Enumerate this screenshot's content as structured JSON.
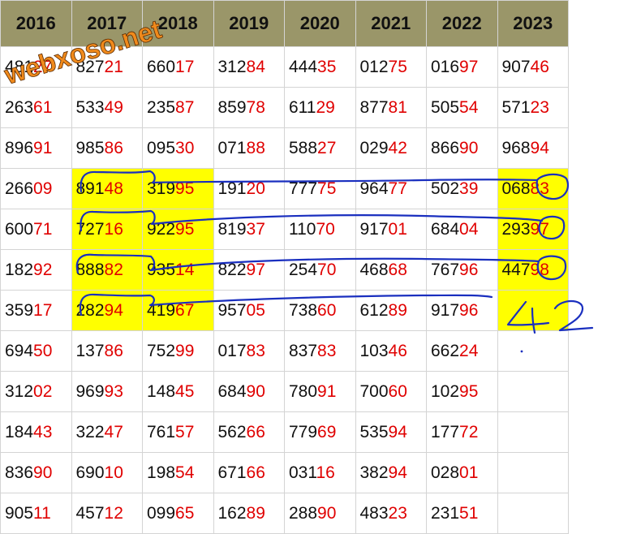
{
  "watermark": "webxoso.net",
  "headers": [
    "2016",
    "2017",
    "2018",
    "2019",
    "2020",
    "2021",
    "2022",
    "2023"
  ],
  "highlight_color": "#ffff00",
  "header_color": "#9a9669",
  "accent_red": "#e00000",
  "rows": [
    [
      {
        "h": "481",
        "l": "27"
      },
      {
        "h": "827",
        "l": "21"
      },
      {
        "h": "660",
        "l": "17"
      },
      {
        "h": "312",
        "l": "84"
      },
      {
        "h": "444",
        "l": "35"
      },
      {
        "h": "012",
        "l": "75"
      },
      {
        "h": "016",
        "l": "97"
      },
      {
        "h": "907",
        "l": "46"
      }
    ],
    [
      {
        "h": "263",
        "l": "61"
      },
      {
        "h": "533",
        "l": "49"
      },
      {
        "h": "235",
        "l": "87"
      },
      {
        "h": "859",
        "l": "78"
      },
      {
        "h": "611",
        "l": "29"
      },
      {
        "h": "877",
        "l": "81"
      },
      {
        "h": "505",
        "l": "54"
      },
      {
        "h": "571",
        "l": "23"
      }
    ],
    [
      {
        "h": "896",
        "l": "91"
      },
      {
        "h": "985",
        "l": "86"
      },
      {
        "h": "095",
        "l": "30"
      },
      {
        "h": "071",
        "l": "88"
      },
      {
        "h": "588",
        "l": "27"
      },
      {
        "h": "029",
        "l": "42"
      },
      {
        "h": "866",
        "l": "90"
      },
      {
        "h": "968",
        "l": "94"
      }
    ],
    [
      {
        "h": "266",
        "l": "09"
      },
      {
        "h": "891",
        "l": "48",
        "hl": true
      },
      {
        "h": "319",
        "l": "95",
        "hl": true
      },
      {
        "h": "191",
        "l": "20"
      },
      {
        "h": "777",
        "l": "75"
      },
      {
        "h": "964",
        "l": "77"
      },
      {
        "h": "502",
        "l": "39"
      },
      {
        "h": "068",
        "l": "83",
        "hl": true
      }
    ],
    [
      {
        "h": "600",
        "l": "71"
      },
      {
        "h": "727",
        "l": "16",
        "hl": true
      },
      {
        "h": "922",
        "l": "95",
        "hl": true
      },
      {
        "h": "819",
        "l": "37"
      },
      {
        "h": "110",
        "l": "70"
      },
      {
        "h": "917",
        "l": "01"
      },
      {
        "h": "684",
        "l": "04"
      },
      {
        "h": "293",
        "l": "97",
        "hl": true
      }
    ],
    [
      {
        "h": "182",
        "l": "92"
      },
      {
        "h": "888",
        "l": "82",
        "hl": true
      },
      {
        "h": "935",
        "l": "14",
        "hl": true
      },
      {
        "h": "822",
        "l": "97"
      },
      {
        "h": "254",
        "l": "70"
      },
      {
        "h": "468",
        "l": "68"
      },
      {
        "h": "767",
        "l": "96"
      },
      {
        "h": "447",
        "l": "98",
        "hl": true
      }
    ],
    [
      {
        "h": "359",
        "l": "17"
      },
      {
        "h": "282",
        "l": "94",
        "hl": true
      },
      {
        "h": "419",
        "l": "67",
        "hl": true
      },
      {
        "h": "957",
        "l": "05"
      },
      {
        "h": "738",
        "l": "60"
      },
      {
        "h": "612",
        "l": "89"
      },
      {
        "h": "917",
        "l": "96"
      },
      {
        "h": "",
        "l": "",
        "hl": true
      }
    ],
    [
      {
        "h": "694",
        "l": "50"
      },
      {
        "h": "137",
        "l": "86"
      },
      {
        "h": "752",
        "l": "99"
      },
      {
        "h": "017",
        "l": "83"
      },
      {
        "h": "837",
        "l": "83"
      },
      {
        "h": "103",
        "l": "46"
      },
      {
        "h": "662",
        "l": "24"
      },
      {
        "h": "",
        "l": ""
      }
    ],
    [
      {
        "h": "312",
        "l": "02"
      },
      {
        "h": "969",
        "l": "93"
      },
      {
        "h": "148",
        "l": "45"
      },
      {
        "h": "684",
        "l": "90"
      },
      {
        "h": "780",
        "l": "91"
      },
      {
        "h": "700",
        "l": "60"
      },
      {
        "h": "102",
        "l": "95"
      },
      {
        "h": "",
        "l": ""
      }
    ],
    [
      {
        "h": "184",
        "l": "43"
      },
      {
        "h": "322",
        "l": "47"
      },
      {
        "h": "761",
        "l": "57"
      },
      {
        "h": "562",
        "l": "66"
      },
      {
        "h": "779",
        "l": "69"
      },
      {
        "h": "535",
        "l": "94"
      },
      {
        "h": "177",
        "l": "72"
      },
      {
        "h": "",
        "l": ""
      }
    ],
    [
      {
        "h": "836",
        "l": "90"
      },
      {
        "h": "690",
        "l": "10"
      },
      {
        "h": "198",
        "l": "54"
      },
      {
        "h": "671",
        "l": "66"
      },
      {
        "h": "031",
        "l": "16"
      },
      {
        "h": "382",
        "l": "94"
      },
      {
        "h": "028",
        "l": "01"
      },
      {
        "h": "",
        "l": ""
      }
    ],
    [
      {
        "h": "905",
        "l": "11"
      },
      {
        "h": "457",
        "l": "12"
      },
      {
        "h": "099",
        "l": "65"
      },
      {
        "h": "162",
        "l": "89"
      },
      {
        "h": "288",
        "l": "90"
      },
      {
        "h": "483",
        "l": "23"
      },
      {
        "h": "231",
        "l": "51"
      },
      {
        "h": "",
        "l": ""
      }
    ]
  ],
  "handwriting": {
    "text": "42",
    "ink_color": "#1a2fbf"
  }
}
